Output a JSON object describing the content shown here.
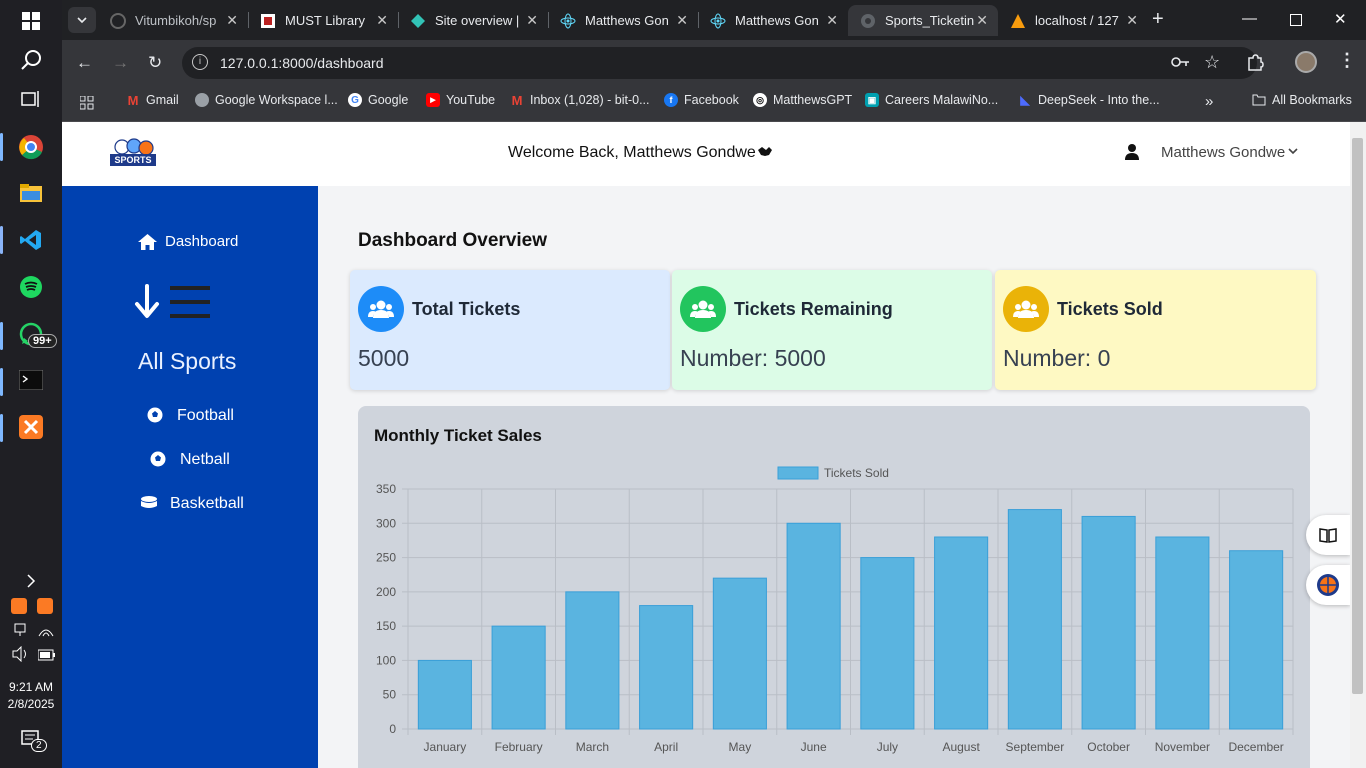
{
  "taskbar": {
    "whatsapp_badge": "99+",
    "time": "9:21 AM",
    "date": "2/8/2025",
    "notifications_count": "2"
  },
  "browser": {
    "tabs": [
      {
        "title": "Vitumbikoh/sp",
        "icon": "github-icon"
      },
      {
        "title": "MUST Library",
        "icon": "library-icon"
      },
      {
        "title": "Site overview |",
        "icon": "netlify-icon"
      },
      {
        "title": "Matthews Gon",
        "icon": "react-icon"
      },
      {
        "title": "Matthews Gon",
        "icon": "react-icon"
      },
      {
        "title": "Sports_Ticketin",
        "icon": "globe-icon"
      },
      {
        "title": "localhost / 127",
        "icon": "phpmyadmin-icon"
      }
    ],
    "url": "127.0.0.1:8000/dashboard",
    "bookmarks": [
      {
        "label": "Gmail",
        "icon": "gmail-icon",
        "color": "#ea4335"
      },
      {
        "label": "Google Workspace l...",
        "icon": "globe-icon",
        "color": "#5f6368"
      },
      {
        "label": "Google",
        "icon": "google-icon",
        "color": "#4285f4"
      },
      {
        "label": "YouTube",
        "icon": "youtube-icon",
        "color": "#ff0000"
      },
      {
        "label": "Inbox (1,028) - bit-0...",
        "icon": "gmail-icon",
        "color": "#ea4335"
      },
      {
        "label": "Facebook",
        "icon": "facebook-icon",
        "color": "#1877f2"
      },
      {
        "label": "MatthewsGPT",
        "icon": "openai-icon",
        "color": "#111111"
      },
      {
        "label": "Careers MalawiNo...",
        "icon": "careers-icon",
        "color": "#00a0b0"
      },
      {
        "label": "DeepSeek - Into the...",
        "icon": "deepseek-icon",
        "color": "#4d6bfe"
      }
    ],
    "all_bookmarks": "All Bookmarks"
  },
  "header": {
    "logo_text": "SPORTS",
    "welcome": "Welcome Back, Matthews Gondwe",
    "user_name": "Matthews Gondwe"
  },
  "sidebar": {
    "dashboard": "Dashboard",
    "all_sports": "All Sports",
    "items": [
      {
        "label": "Football",
        "icon": "soccer-ball-icon"
      },
      {
        "label": "Netball",
        "icon": "soccer-ball-icon"
      },
      {
        "label": "Basketball",
        "icon": "database-icon"
      }
    ]
  },
  "main": {
    "title": "Dashboard Overview",
    "cards": [
      {
        "title": "Total Tickets",
        "value": "5000",
        "bg": "#dbeafe",
        "icon_bg": "#1d8cf8"
      },
      {
        "title": "Tickets Remaining",
        "value": "Number: 5000",
        "bg": "#dcfce7",
        "icon_bg": "#22c55e"
      },
      {
        "title": "Tickets Sold",
        "value": "Number: 0",
        "bg": "#fef9c3",
        "icon_bg": "#eab308"
      }
    ],
    "chart_title": "Monthly Ticket Sales"
  },
  "chart_data": {
    "type": "bar",
    "title": "",
    "xlabel": "",
    "ylabel": "",
    "categories": [
      "January",
      "February",
      "March",
      "April",
      "May",
      "June",
      "July",
      "August",
      "September",
      "October",
      "November",
      "December"
    ],
    "series": [
      {
        "name": "Tickets Sold",
        "values": [
          100,
          150,
          200,
          180,
          220,
          300,
          250,
          280,
          320,
          310,
          280,
          260
        ],
        "color": "#5ab4e0"
      }
    ],
    "ylim": [
      0,
      350
    ],
    "yticks": [
      0,
      50,
      100,
      150,
      200,
      250,
      300,
      350
    ],
    "grid": true,
    "legend": "top-center"
  }
}
